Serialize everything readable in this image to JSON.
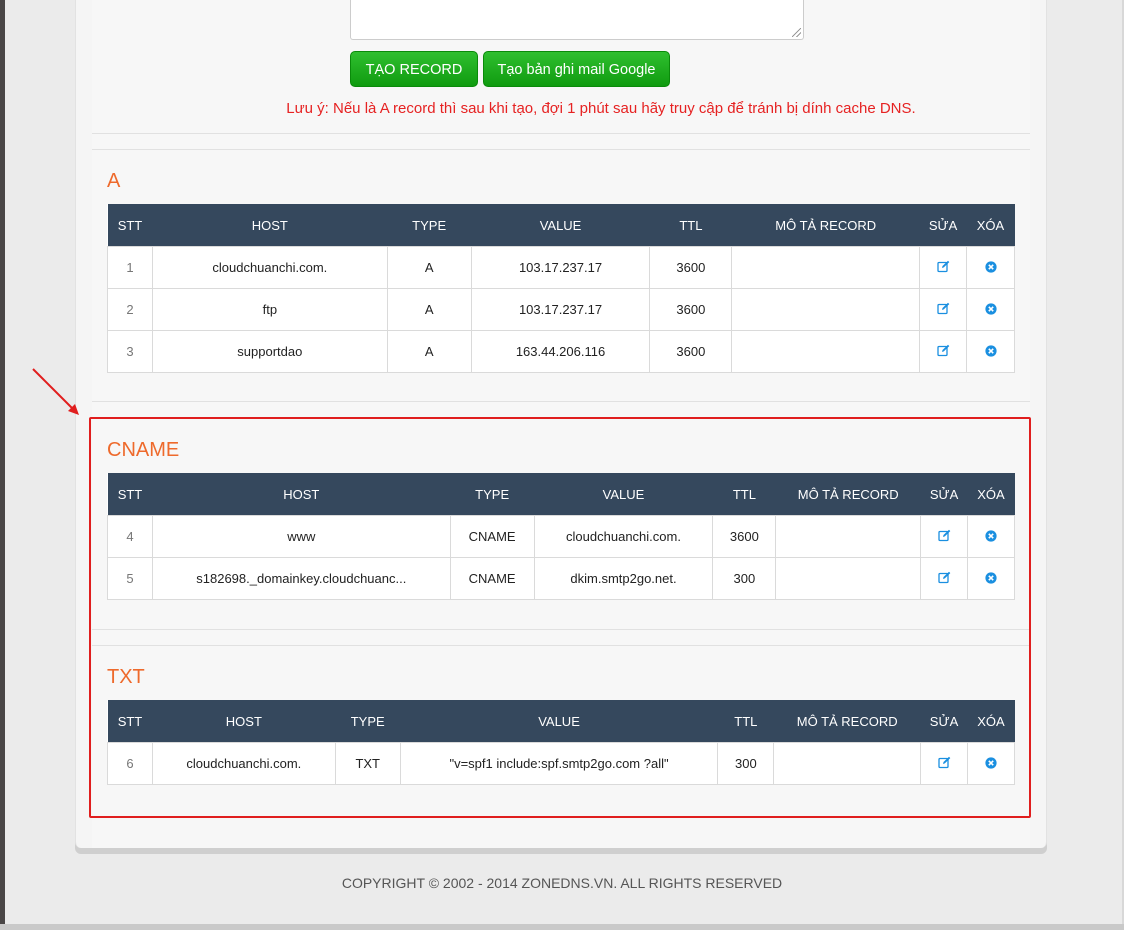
{
  "form": {
    "create_button": "TẠO RECORD",
    "google_button": "Tạo bản ghi mail Google",
    "note": "Lưu ý: Nếu là A record thì sau khi tạo, đợi 1 phút sau hãy truy cập để tránh bị dính cache DNS."
  },
  "columns": {
    "stt": "STT",
    "host": "HOST",
    "type": "TYPE",
    "value": "VALUE",
    "ttl": "TTL",
    "desc": "MÔ TẢ RECORD",
    "edit": "SỬA",
    "delete": "XÓA"
  },
  "sections": {
    "a": {
      "title": "A",
      "rows": [
        {
          "stt": "1",
          "host": "cloudchuanchi.com.",
          "type": "A",
          "value": "103.17.237.17",
          "ttl": "3600",
          "desc": ""
        },
        {
          "stt": "2",
          "host": "ftp",
          "type": "A",
          "value": "103.17.237.17",
          "ttl": "3600",
          "desc": ""
        },
        {
          "stt": "3",
          "host": "supportdao",
          "type": "A",
          "value": "163.44.206.116",
          "ttl": "3600",
          "desc": ""
        }
      ]
    },
    "cname": {
      "title": "CNAME",
      "rows": [
        {
          "stt": "4",
          "host": "www",
          "type": "CNAME",
          "value": "cloudchuanchi.com.",
          "ttl": "3600",
          "desc": ""
        },
        {
          "stt": "5",
          "host": "s182698._domainkey.cloudchuanc...",
          "type": "CNAME",
          "value": "dkim.smtp2go.net.",
          "ttl": "300",
          "desc": ""
        }
      ]
    },
    "txt": {
      "title": "TXT",
      "rows": [
        {
          "stt": "6",
          "host": "cloudchuanchi.com.",
          "type": "TXT",
          "value": "\"v=spf1 include:spf.smtp2go.com ?all\"",
          "ttl": "300",
          "desc": ""
        }
      ]
    }
  },
  "icons": {
    "edit": "edit-icon",
    "delete": "delete-icon",
    "accent_color": "#1a8fe0"
  },
  "footer": {
    "text": "COPYRIGHT © 2002 - 2014 ZONEDNS.VN. ALL RIGHTS RESERVED"
  }
}
